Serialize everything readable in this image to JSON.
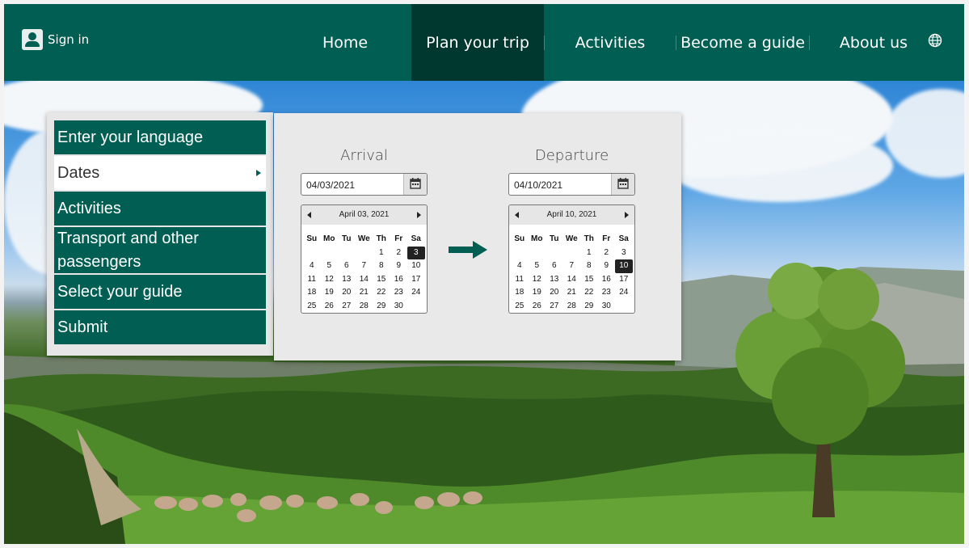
{
  "header": {
    "signin_label": "Sign in",
    "nav": [
      {
        "label": "Home"
      },
      {
        "label": "Plan your trip",
        "active": true
      },
      {
        "label": "Activities"
      },
      {
        "label": "Become a guide"
      },
      {
        "label": "About us"
      }
    ],
    "language_icon": "globe-icon"
  },
  "side_menu": {
    "items": [
      {
        "label": "Enter your language"
      },
      {
        "label": "Dates",
        "selected": true
      },
      {
        "label": "Activities"
      },
      {
        "label": "Transport and other passengers"
      },
      {
        "label": "Select your guide"
      },
      {
        "label": "Submit"
      }
    ]
  },
  "dates": {
    "arrival": {
      "title": "Arrival",
      "value": "04/03/2021",
      "calendar_header": "April 03, 2021",
      "selected_day": "3"
    },
    "departure": {
      "title": "Departure",
      "value": "04/10/2021",
      "calendar_header": "April 10, 2021",
      "selected_day": "10"
    },
    "weekdays": [
      "Su",
      "Mo",
      "Tu",
      "We",
      "Th",
      "Fr",
      "Sa"
    ],
    "weeks": [
      [
        "",
        "",
        "",
        "",
        "1",
        "2",
        "3"
      ],
      [
        "4",
        "5",
        "6",
        "7",
        "8",
        "9",
        "10"
      ],
      [
        "11",
        "12",
        "13",
        "14",
        "15",
        "16",
        "17"
      ],
      [
        "18",
        "19",
        "20",
        "21",
        "22",
        "23",
        "24"
      ],
      [
        "25",
        "26",
        "27",
        "28",
        "29",
        "30",
        ""
      ]
    ]
  },
  "colors": {
    "brand_green": "#005e52",
    "active_nav": "#00382f"
  }
}
